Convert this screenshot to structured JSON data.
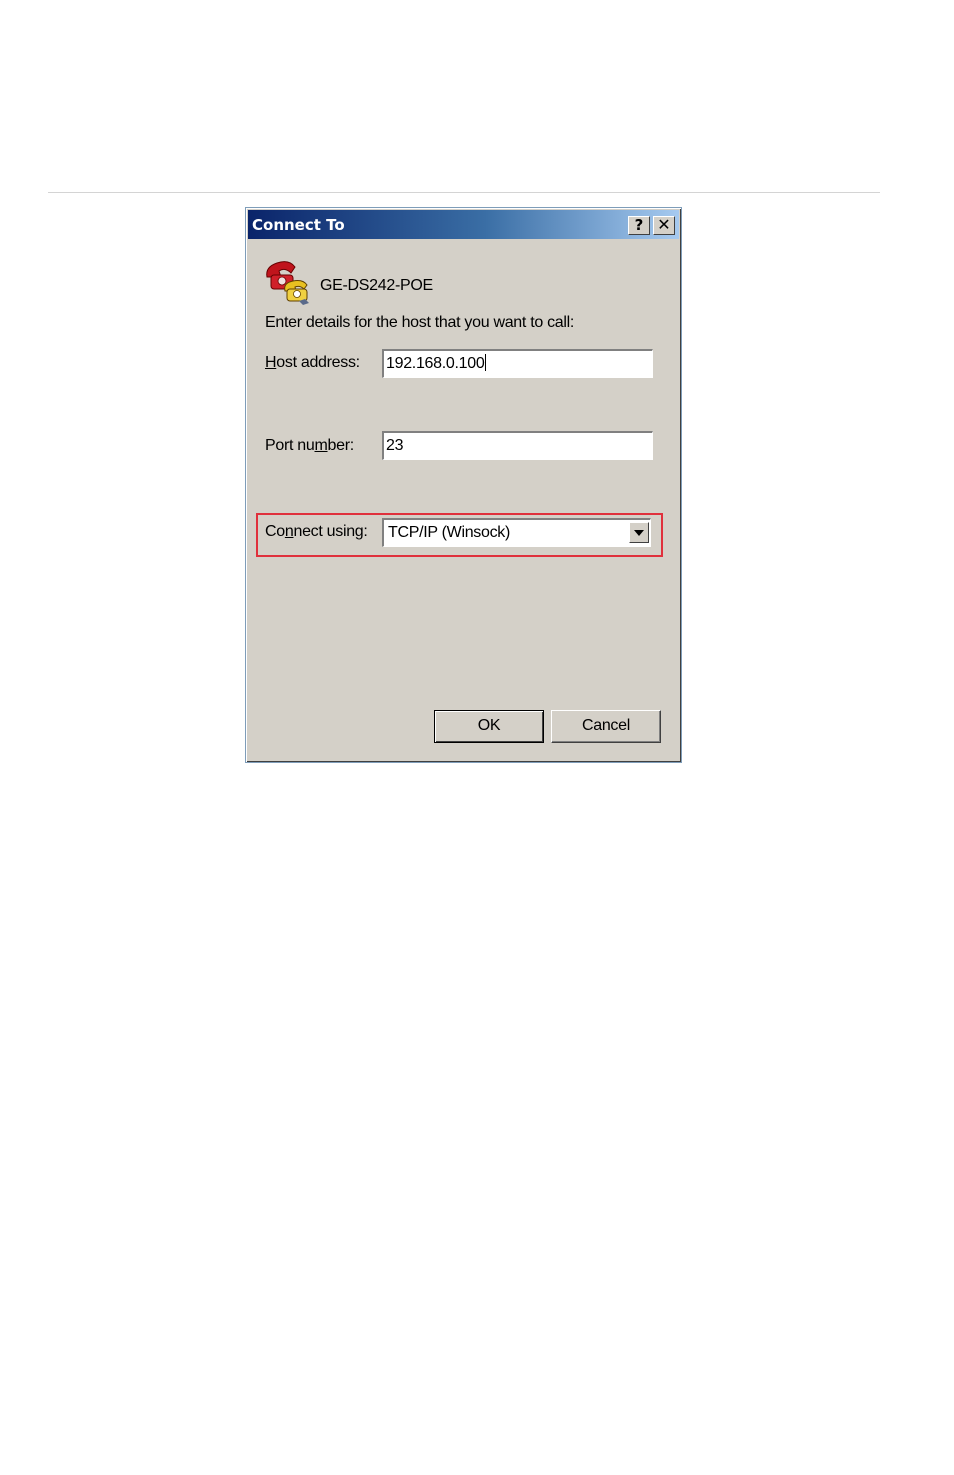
{
  "dialog": {
    "title": "Connect To",
    "help_glyph": "?",
    "close_glyph": "✕",
    "icon": "phone-connection-icon",
    "connection_name": "GE-DS242-POE",
    "instructions": "Enter details for the host that you want to call:",
    "host": {
      "label_pre": "",
      "label_ul": "H",
      "label_post": "ost address:",
      "value": "192.168.0.100"
    },
    "port": {
      "label_pre": "Port nu",
      "label_ul": "m",
      "label_post": "ber:",
      "value": "23"
    },
    "connect_using": {
      "label_pre": "Co",
      "label_ul": "n",
      "label_post": "nect using:",
      "value": "TCP/IP (Winsock)"
    },
    "ok_label": "OK",
    "cancel_label": "Cancel"
  },
  "colors": {
    "dialog_bg": "#d4d0c8",
    "title_gradient_start": "#0a246a",
    "title_gradient_end": "#a6caf0",
    "highlight": "#e0303c"
  }
}
